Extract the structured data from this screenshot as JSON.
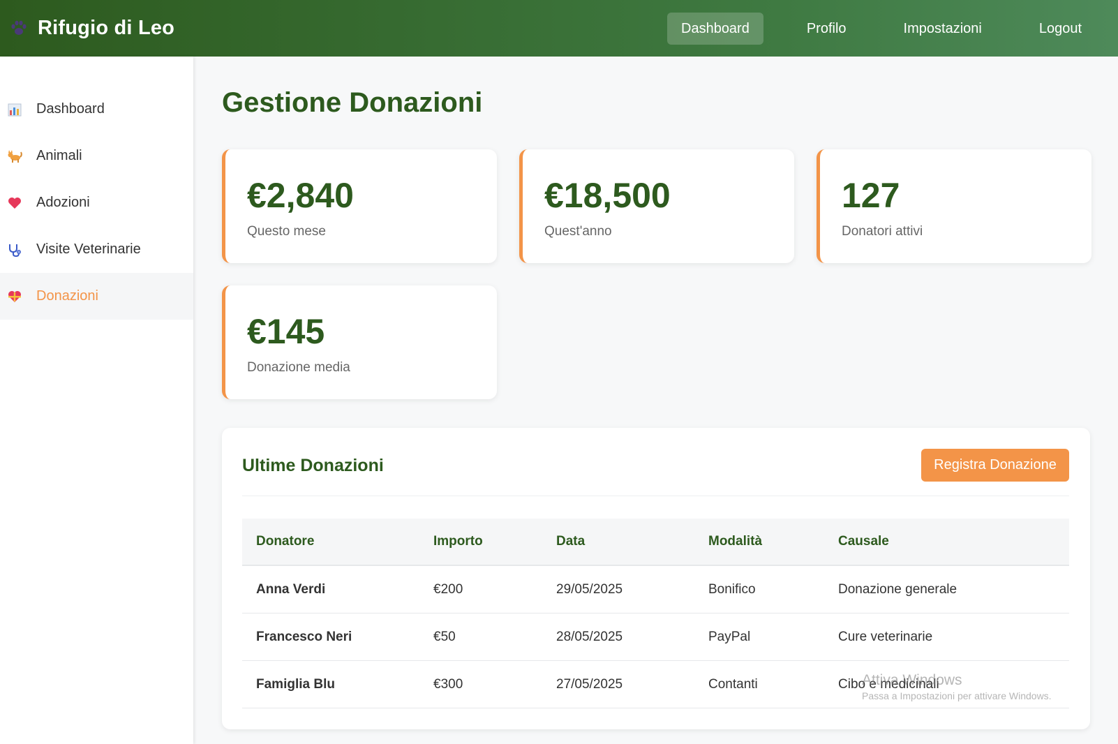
{
  "app": {
    "brand_title": "Rifugio di Leo",
    "brand_icon": "paw-icon"
  },
  "topnav": {
    "items": [
      {
        "label": "Dashboard",
        "active": true
      },
      {
        "label": "Profilo",
        "active": false
      },
      {
        "label": "Impostazioni",
        "active": false
      },
      {
        "label": "Logout",
        "active": false
      }
    ]
  },
  "sidebar": {
    "items": [
      {
        "label": "Dashboard",
        "icon": "bar-chart-icon",
        "active": false
      },
      {
        "label": "Animali",
        "icon": "cat-icon",
        "active": false
      },
      {
        "label": "Adozioni",
        "icon": "heart-icon",
        "active": false
      },
      {
        "label": "Visite Veterinarie",
        "icon": "stethoscope-icon",
        "active": false
      },
      {
        "label": "Donazioni",
        "icon": "heart-gift-icon",
        "active": true
      }
    ]
  },
  "main": {
    "title": "Gestione Donazioni",
    "stats": [
      {
        "value": "€2,840",
        "label": "Questo mese"
      },
      {
        "value": "€18,500",
        "label": "Quest'anno"
      },
      {
        "value": "127",
        "label": "Donatori attivi"
      },
      {
        "value": "€145",
        "label": "Donazione media"
      }
    ]
  },
  "donations_panel": {
    "title": "Ultime Donazioni",
    "button_label": "Registra Donazione",
    "columns": [
      "Donatore",
      "Importo",
      "Data",
      "Modalità",
      "Causale"
    ],
    "rows": [
      [
        "Anna Verdi",
        "€200",
        "29/05/2025",
        "Bonifico",
        "Donazione generale"
      ],
      [
        "Francesco Neri",
        "€50",
        "28/05/2025",
        "PayPal",
        "Cure veterinarie"
      ],
      [
        "Famiglia Blu",
        "€300",
        "27/05/2025",
        "Contanti",
        "Cibo e medicinali"
      ]
    ]
  },
  "watermark": {
    "title": "Attiva Windows",
    "subtitle": "Passa a Impostazioni per attivare Windows."
  },
  "colors": {
    "primary_green": "#2d5a1e",
    "accent_orange": "#f39448"
  }
}
